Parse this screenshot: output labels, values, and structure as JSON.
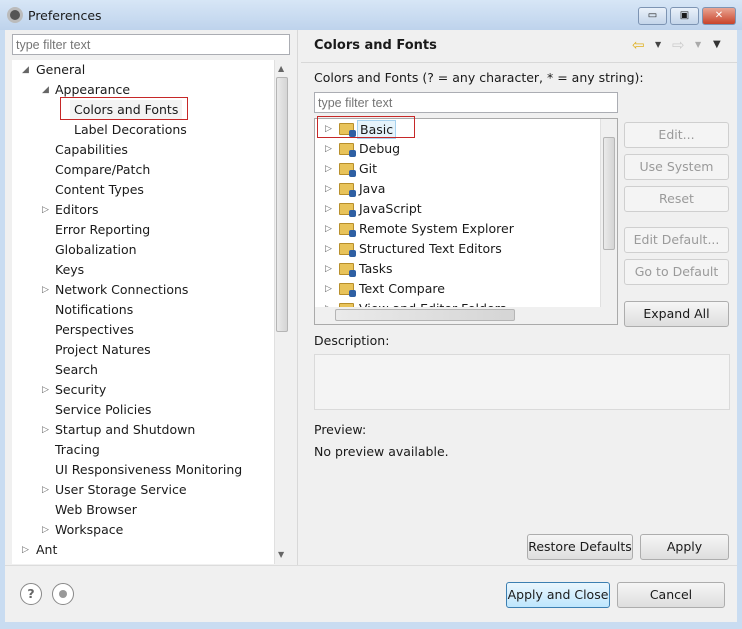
{
  "window": {
    "title": "Preferences",
    "controls": [
      "minimize",
      "maximize",
      "close"
    ]
  },
  "left": {
    "filter_placeholder": "type filter text",
    "tree": [
      {
        "label": "General",
        "level": 0,
        "state": "expanded"
      },
      {
        "label": "Appearance",
        "level": 1,
        "state": "expanded"
      },
      {
        "label": "Colors and Fonts",
        "level": 2,
        "state": "leaf",
        "selected": true
      },
      {
        "label": "Label Decorations",
        "level": 2,
        "state": "leaf"
      },
      {
        "label": "Capabilities",
        "level": 1,
        "state": "leaf"
      },
      {
        "label": "Compare/Patch",
        "level": 1,
        "state": "leaf"
      },
      {
        "label": "Content Types",
        "level": 1,
        "state": "leaf"
      },
      {
        "label": "Editors",
        "level": 1,
        "state": "collapsed"
      },
      {
        "label": "Error Reporting",
        "level": 1,
        "state": "leaf"
      },
      {
        "label": "Globalization",
        "level": 1,
        "state": "leaf"
      },
      {
        "label": "Keys",
        "level": 1,
        "state": "leaf"
      },
      {
        "label": "Network Connections",
        "level": 1,
        "state": "collapsed"
      },
      {
        "label": "Notifications",
        "level": 1,
        "state": "leaf"
      },
      {
        "label": "Perspectives",
        "level": 1,
        "state": "leaf"
      },
      {
        "label": "Project Natures",
        "level": 1,
        "state": "leaf"
      },
      {
        "label": "Search",
        "level": 1,
        "state": "leaf"
      },
      {
        "label": "Security",
        "level": 1,
        "state": "collapsed"
      },
      {
        "label": "Service Policies",
        "level": 1,
        "state": "leaf"
      },
      {
        "label": "Startup and Shutdown",
        "level": 1,
        "state": "collapsed"
      },
      {
        "label": "Tracing",
        "level": 1,
        "state": "leaf"
      },
      {
        "label": "UI Responsiveness Monitoring",
        "level": 1,
        "state": "leaf"
      },
      {
        "label": "User Storage Service",
        "level": 1,
        "state": "collapsed"
      },
      {
        "label": "Web Browser",
        "level": 1,
        "state": "leaf"
      },
      {
        "label": "Workspace",
        "level": 1,
        "state": "collapsed"
      },
      {
        "label": "Ant",
        "level": 0,
        "state": "collapsed"
      }
    ]
  },
  "right": {
    "title": "Colors and Fonts",
    "nav_icons": [
      "back-arrow-icon",
      "forward-arrow-icon",
      "view-menu-icon"
    ],
    "filter_label": "Colors and Fonts (? = any character, * = any string):",
    "filter_placeholder": "type filter text",
    "tree": [
      "Basic",
      "Debug",
      "Git",
      "Java",
      "JavaScript",
      "Remote System Explorer",
      "Structured Text Editors",
      "Tasks",
      "Text Compare",
      "View and Editor Folders"
    ],
    "buttons": {
      "edit": "Edit...",
      "use_system_font": "Use System Font",
      "reset": "Reset",
      "edit_default": "Edit Default...",
      "go_to_default": "Go to Default",
      "expand_all": "Expand All"
    },
    "description_label": "Description:",
    "preview_label": "Preview:",
    "preview_text": "No preview available.",
    "restore_defaults": "Restore Defaults",
    "apply": "Apply"
  },
  "footer": {
    "apply_and_close": "Apply and Close",
    "cancel": "Cancel"
  },
  "colors": {
    "highlight_box": "#c62828",
    "title_bar": "#c9dcf1"
  }
}
